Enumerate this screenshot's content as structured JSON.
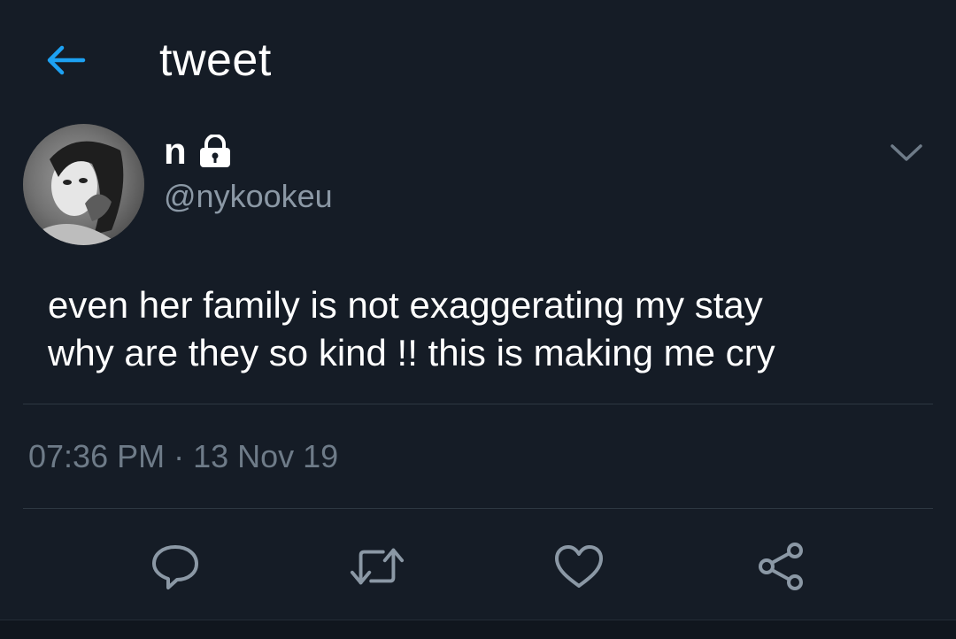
{
  "header": {
    "title": "tweet",
    "back_icon": "arrow-left-icon",
    "accent_color": "#1da1f2"
  },
  "tweet": {
    "author": {
      "display_name": "n",
      "protected_icon": "lock-icon",
      "handle": "@nykookeu",
      "avatar": "avatar-photo"
    },
    "menu_icon": "chevron-down-icon",
    "text_lines": [
      "even her family is not exaggerating my stay",
      "why are they so kind !! this is making me cry"
    ],
    "timestamp": "07:36 PM · 13 Nov 19"
  },
  "actions": [
    {
      "name": "reply",
      "icon": "reply-icon"
    },
    {
      "name": "retweet",
      "icon": "retweet-icon"
    },
    {
      "name": "like",
      "icon": "heart-icon"
    },
    {
      "name": "share",
      "icon": "share-icon"
    }
  ],
  "colors": {
    "background": "#151c26",
    "text": "#ffffff",
    "secondary": "#8b98a5",
    "divider": "#2d3741"
  }
}
